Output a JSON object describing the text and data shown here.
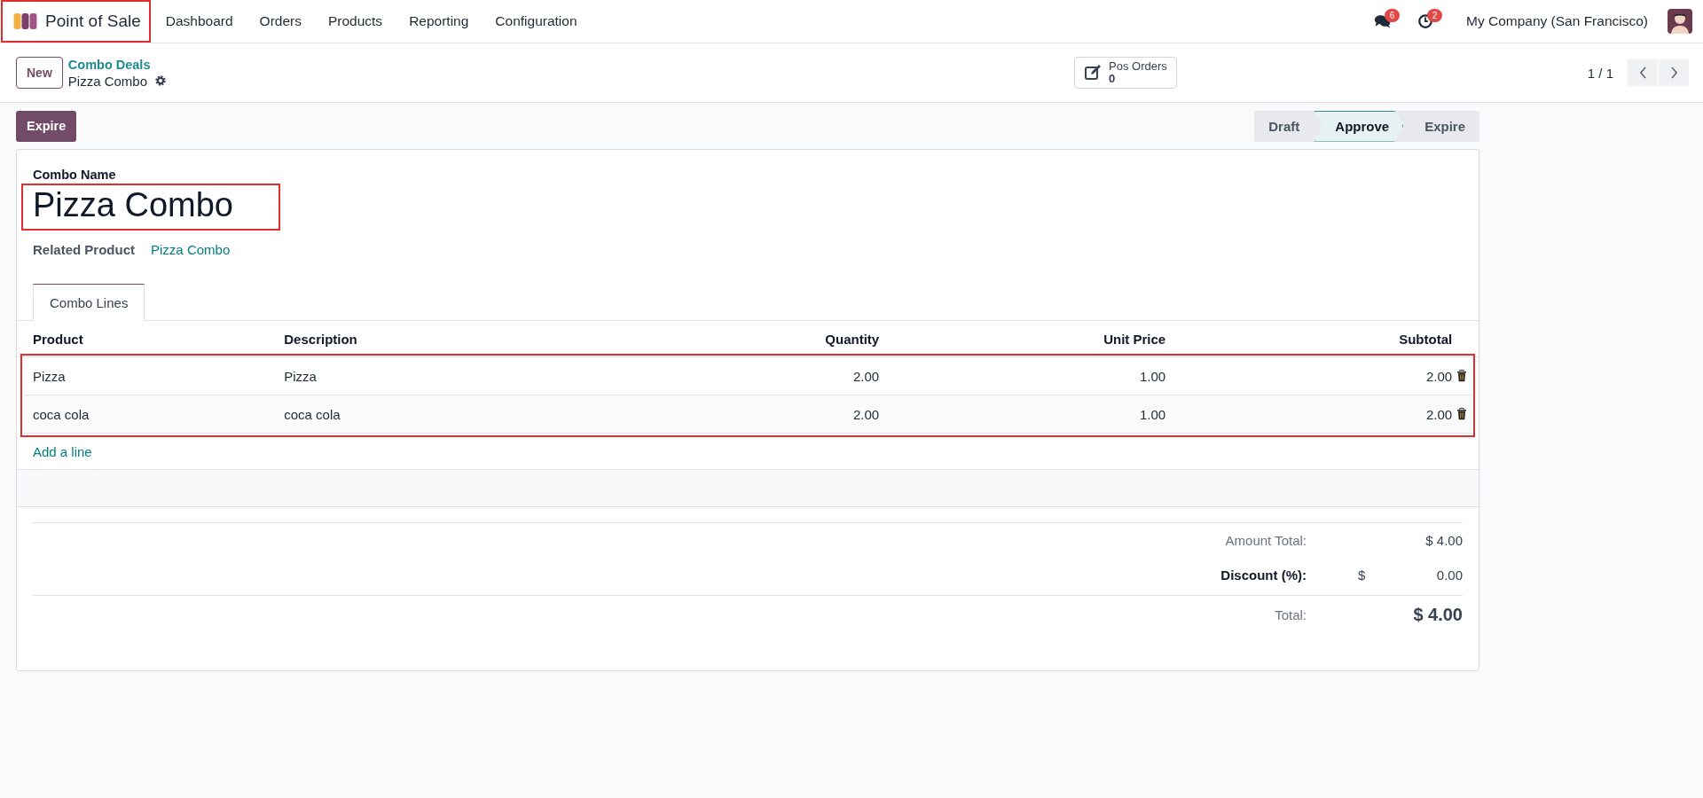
{
  "navbar": {
    "app_name": "Point of Sale",
    "highlighted": true,
    "menu": [
      "Dashboard",
      "Orders",
      "Products",
      "Reporting",
      "Configuration"
    ],
    "messages_badge": "6",
    "activities_badge": "2",
    "company": "My Company (San Francisco)"
  },
  "control_panel": {
    "new_button": "New",
    "breadcrumb": "Combo Deals",
    "record": "Pizza Combo",
    "smart_button": {
      "label": "Pos Orders",
      "count": "0"
    },
    "pager": "1 / 1"
  },
  "action_buttons": [
    "Expire"
  ],
  "statusbar": [
    {
      "label": "Draft",
      "selected": false
    },
    {
      "label": "Approve",
      "selected": true
    },
    {
      "label": "Expire",
      "selected": false
    }
  ],
  "form": {
    "name_label": "Combo Name",
    "name": "Pizza Combo",
    "name_highlighted": true,
    "related_product_label": "Related Product",
    "related_product": "Pizza Combo",
    "tabs": [
      {
        "label": "Combo Lines",
        "selected": true
      }
    ],
    "table": {
      "columns": [
        "Product",
        "Description",
        "Quantity",
        "Unit Price",
        "Subtotal"
      ],
      "rows_highlighted": true,
      "rows": [
        {
          "product": "Pizza",
          "description": "Pizza",
          "quantity": "2.00",
          "unit_price": "1.00",
          "subtotal": "2.00"
        },
        {
          "product": "coca cola",
          "description": "coca cola",
          "quantity": "2.00",
          "unit_price": "1.00",
          "subtotal": "2.00"
        }
      ],
      "add_line": "Add a line"
    },
    "totals": {
      "amount_total_label": "Amount Total:",
      "amount_total": "$ 4.00",
      "discount_label": "Discount (%):",
      "discount_currency": "$",
      "discount": "0.00",
      "total_label": "Total:",
      "total": "$ 4.00"
    }
  }
}
